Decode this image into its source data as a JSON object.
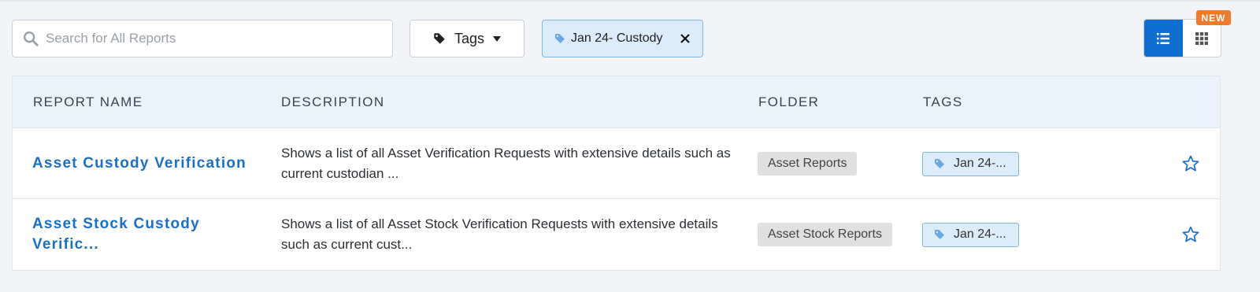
{
  "search": {
    "placeholder": "Search for All Reports",
    "value": ""
  },
  "toolbar": {
    "tags_label": "Tags",
    "active_filter": "Jan 24- Custody",
    "new_badge": "NEW",
    "view_mode": "list"
  },
  "table": {
    "columns": [
      "REPORT NAME",
      "DESCRIPTION",
      "FOLDER",
      "TAGS"
    ],
    "rows": [
      {
        "name": "Asset Custody Verification",
        "description": "Shows a list of all Asset Verification Requests with extensive details such as current custodian ...",
        "folder": "Asset Reports",
        "tag": "Jan 24-...",
        "starred": false
      },
      {
        "name": "Asset Stock Custody Verific...",
        "description": "Shows a list of all Asset Stock Verification Requests with extensive details such as current cust...",
        "folder": "Asset Stock Reports",
        "tag": "Jan 24-...",
        "starred": false
      }
    ]
  },
  "colors": {
    "accent": "#0f6fd0",
    "link": "#1a6fc9",
    "header_bg": "#eaf3fc",
    "badge": "#ee7a2a",
    "tag_bg": "#dcecfb"
  }
}
